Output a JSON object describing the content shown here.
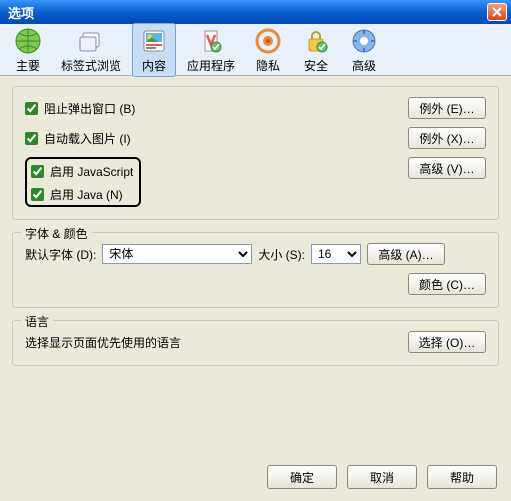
{
  "window": {
    "title": "选项"
  },
  "toolbar": {
    "items": [
      {
        "label": "主要"
      },
      {
        "label": "标签式浏览"
      },
      {
        "label": "内容"
      },
      {
        "label": "应用程序"
      },
      {
        "label": "隐私"
      },
      {
        "label": "安全"
      },
      {
        "label": "高级"
      }
    ],
    "active_index": 2
  },
  "general_group": {
    "block_popup": {
      "label": "阻止弹出窗口 (B)",
      "checked": true,
      "button": "例外 (E)…"
    },
    "auto_load_img": {
      "label": "自动载入图片 (I)",
      "checked": true,
      "button": "例外 (X)…"
    },
    "enable_js": {
      "label": "启用 JavaScript",
      "checked": true,
      "button": "高级 (V)…"
    },
    "enable_java": {
      "label": "启用 Java (N)",
      "checked": true
    }
  },
  "font_group": {
    "title": "字体 & 颜色",
    "default_font_label": "默认字体 (D):",
    "font_value": "宋体",
    "size_label": "大小 (S):",
    "size_value": "16",
    "advanced_button": "高级 (A)…",
    "color_button": "颜色 (C)…"
  },
  "lang_group": {
    "title": "语言",
    "text": "选择显示页面优先使用的语言",
    "button": "选择 (O)…"
  },
  "footer": {
    "ok": "确定",
    "cancel": "取消",
    "help": "帮助"
  }
}
